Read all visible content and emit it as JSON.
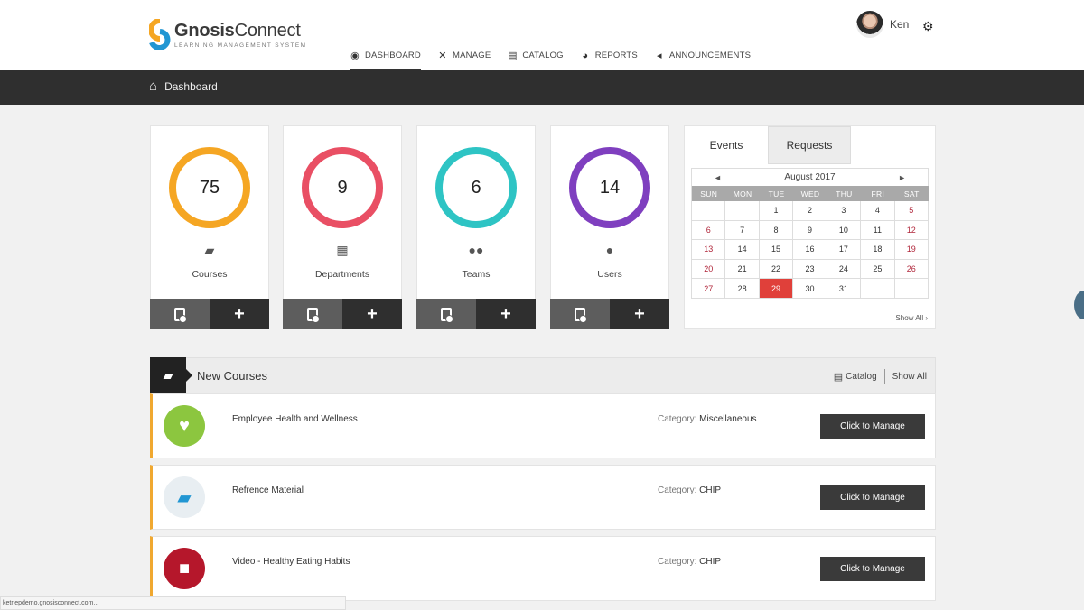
{
  "brand": {
    "name_bold": "Gnosis",
    "name_rest": "Connect",
    "tagline": "LEARNING MANAGEMENT SYSTEM",
    "colors": {
      "orange": "#f5a623",
      "blue": "#2196d3"
    }
  },
  "nav": {
    "items": [
      {
        "label": "DASHBOARD",
        "icon": "dashboard-icon",
        "active": true
      },
      {
        "label": "MANAGE",
        "icon": "tools-icon",
        "active": false
      },
      {
        "label": "CATALOG",
        "icon": "catalog-icon",
        "active": false
      },
      {
        "label": "REPORTS",
        "icon": "pie-chart-icon",
        "active": false
      },
      {
        "label": "ANNOUNCEMENTS",
        "icon": "megaphone-icon",
        "active": false
      }
    ]
  },
  "user": {
    "name": "Ken"
  },
  "breadcrumb": {
    "label": "Dashboard"
  },
  "stats": [
    {
      "value": "75",
      "label": "Courses",
      "icon": "book-icon",
      "color": "#f5a623"
    },
    {
      "value": "9",
      "label": "Departments",
      "icon": "grid-icon",
      "color": "#e94f64"
    },
    {
      "value": "6",
      "label": "Teams",
      "icon": "team-icon",
      "color": "#2ec4c4"
    },
    {
      "value": "14",
      "label": "Users",
      "icon": "user-icon",
      "color": "#7f3fbf"
    }
  ],
  "calendar_panel": {
    "tabs": [
      "Events",
      "Requests"
    ],
    "month_label": "August 2017",
    "days_of_week": [
      "SUN",
      "MON",
      "TUE",
      "WED",
      "THU",
      "FRI",
      "SAT"
    ],
    "cells": [
      "",
      "",
      "1",
      "2",
      "3",
      "4",
      "5",
      "6",
      "7",
      "8",
      "9",
      "10",
      "11",
      "12",
      "13",
      "14",
      "15",
      "16",
      "17",
      "18",
      "19",
      "20",
      "21",
      "22",
      "23",
      "24",
      "25",
      "26",
      "27",
      "28",
      "29",
      "30",
      "31",
      "",
      ""
    ],
    "today": "29",
    "show_all": "Show All ›"
  },
  "new_courses": {
    "title": "New Courses",
    "catalog_link": "Catalog",
    "show_all_link": "Show All",
    "category_label": "Category:",
    "manage_label": "Click to Manage",
    "items": [
      {
        "name": "Employee Health and Wellness",
        "category": "Miscellaneous",
        "icon": "health-icon",
        "color": "#8cc63f"
      },
      {
        "name": "Refrence Material",
        "category": "CHIP",
        "icon": "book-icon",
        "color": "#e8eef2"
      },
      {
        "name": "Video - Healthy Eating Habits",
        "category": "CHIP",
        "icon": "video-camera-icon",
        "color": "#b5172b"
      }
    ]
  },
  "status_bar": {
    "url": "ketriepdemo.gnosisconnect.com..."
  }
}
